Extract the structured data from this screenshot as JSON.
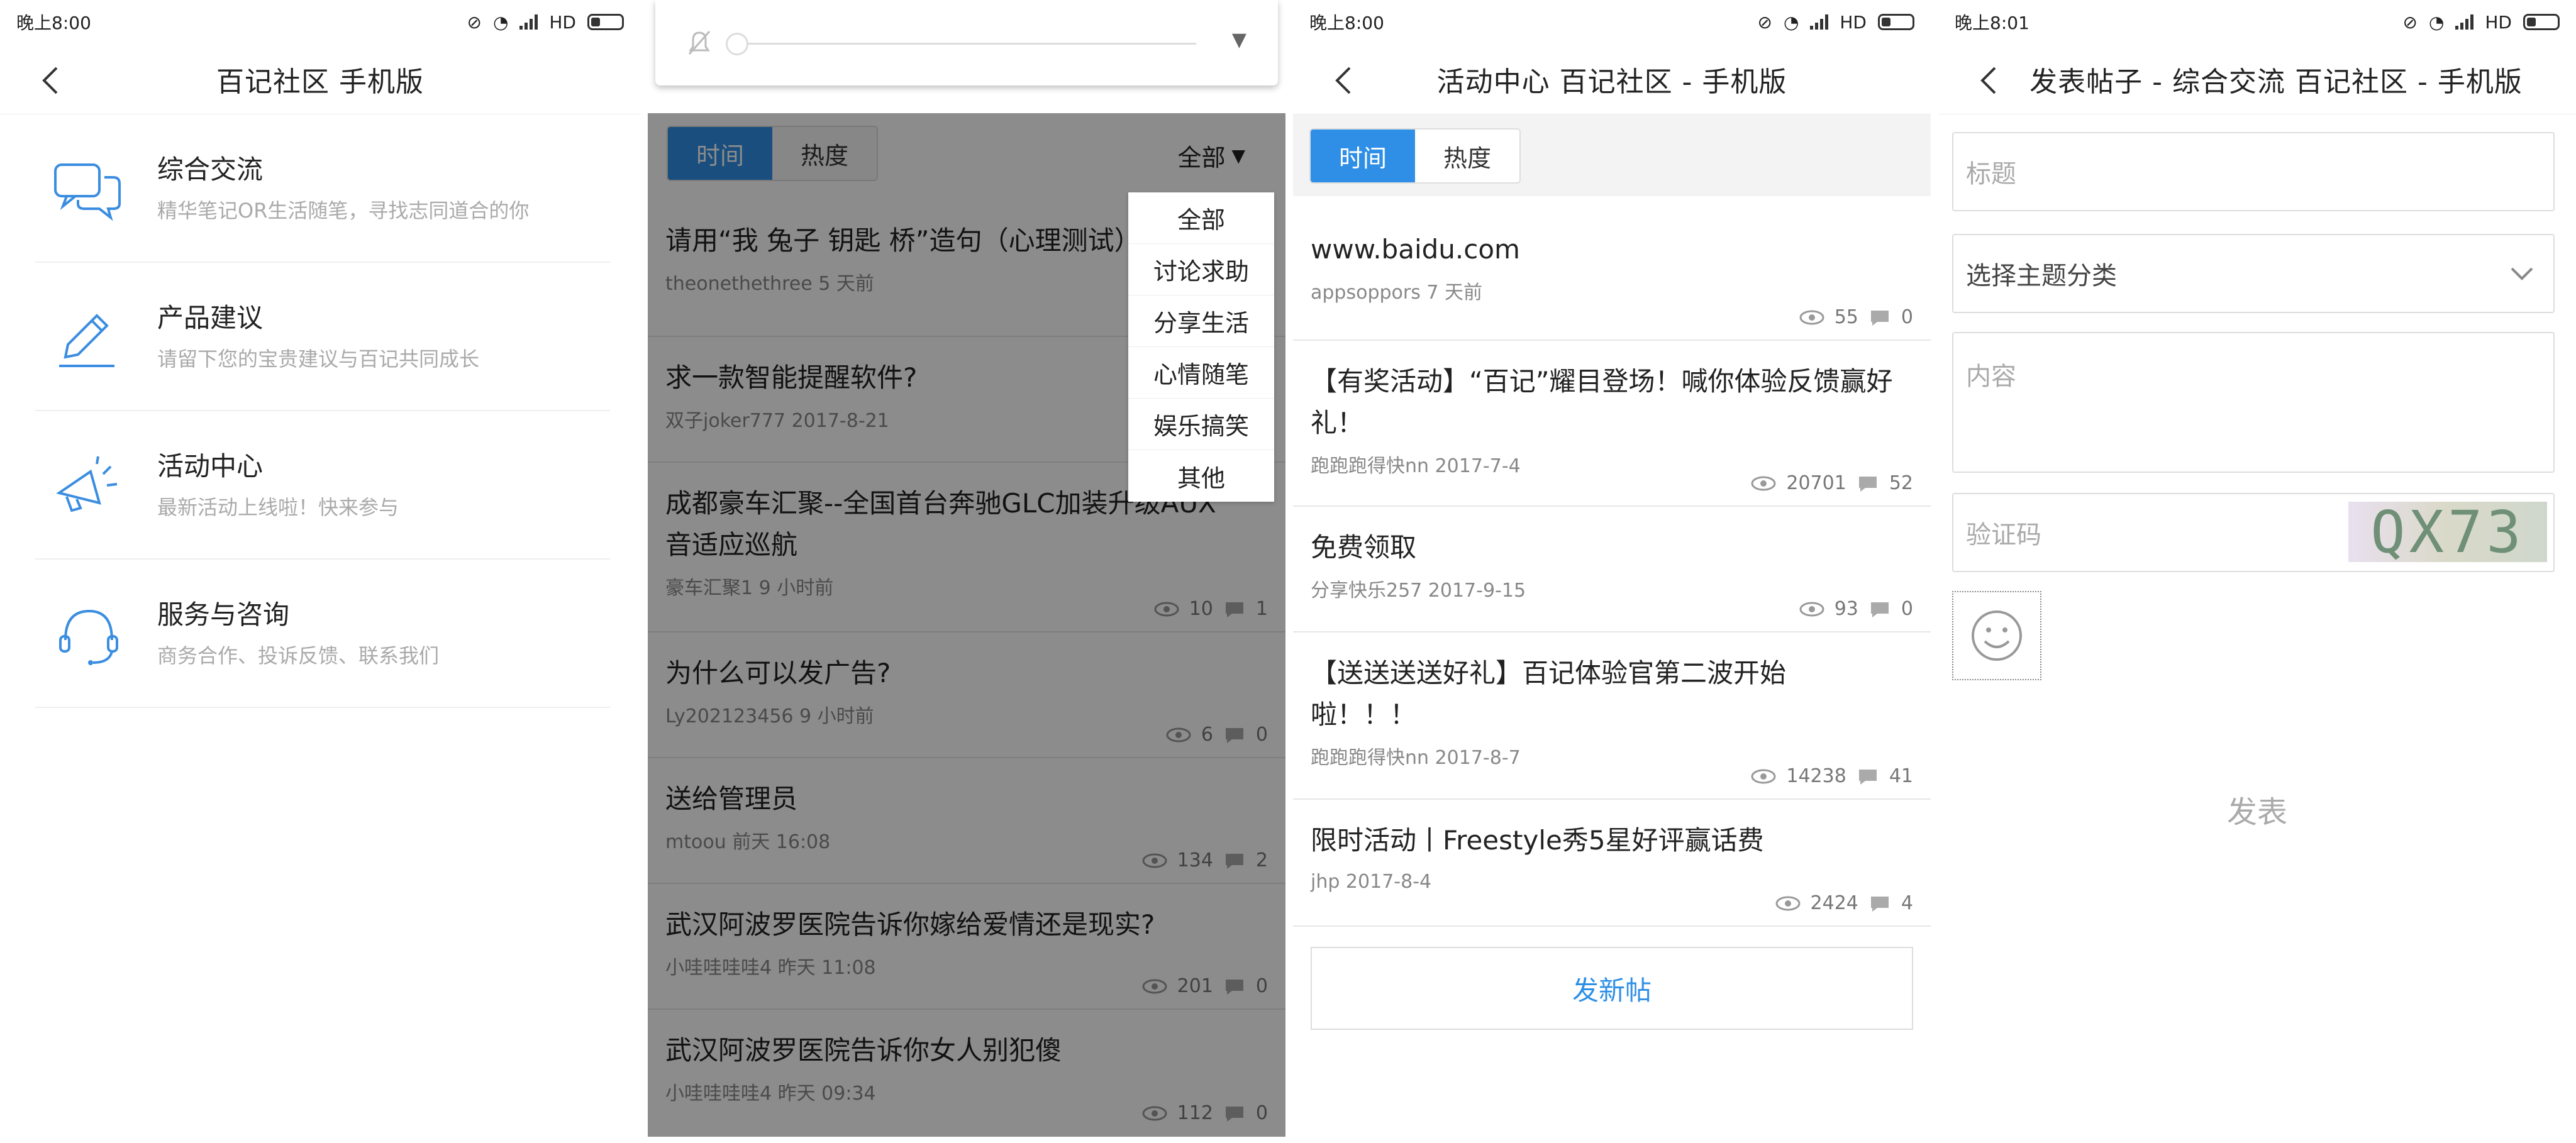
{
  "status_p1": {
    "time": "晚上8:00",
    "net": "HD"
  },
  "status_p3": {
    "time": "晚上8:00",
    "net": "HD"
  },
  "status_p4": {
    "time": "晚上8:01",
    "net": "HD"
  },
  "p1": {
    "title": "百记社区 手机版",
    "items": [
      {
        "name": "综合交流",
        "desc": "精华笔记OR生活随笔，寻找志同道合的你",
        "icon": "chat-icon"
      },
      {
        "name": "产品建议",
        "desc": "请留下您的宝贵建议与百记共同成长",
        "icon": "pen-icon"
      },
      {
        "name": "活动中心",
        "desc": "最新活动上线啦！快来参与",
        "icon": "megaphone-icon"
      },
      {
        "name": "服务与咨询",
        "desc": "商务合作、投诉反馈、联系我们",
        "icon": "headset-icon"
      }
    ]
  },
  "p2": {
    "tabs": {
      "time": "时间",
      "hot": "热度"
    },
    "filter": "全部",
    "dropdown": [
      "全部",
      "讨论求助",
      "分享生活",
      "心情随笔",
      "娱乐搞笑",
      "其他"
    ],
    "rows": [
      {
        "title": "请用“我 兔子 钥匙 桥”造句（心理测试）",
        "meta": "theonethethree 5 天前",
        "views": "",
        "comments": ""
      },
      {
        "title": "求一款智能提醒软件?",
        "meta": "双子joker777 2017-8-21",
        "views": "",
        "comments": ""
      },
      {
        "title": "成都豪车汇聚--全国首台奔驰GLC加装升级AUX音适应巡航",
        "meta": "豪车汇聚1 9 小时前",
        "views": "10",
        "comments": "1"
      },
      {
        "title": "为什么可以发广告?",
        "meta": "Ly202123456 9 小时前",
        "views": "6",
        "comments": "0"
      },
      {
        "title": "送给管理员",
        "meta": "mtoou 前天 16:08",
        "views": "134",
        "comments": "2"
      },
      {
        "title": "武汉阿波罗医院告诉你嫁给爱情还是现实?",
        "meta": "小哇哇哇哇4 昨天 11:08",
        "views": "201",
        "comments": "0"
      },
      {
        "title": "武汉阿波罗医院告诉你女人别犯傻",
        "meta": "小哇哇哇哇4 昨天 09:34",
        "views": "112",
        "comments": "0"
      }
    ]
  },
  "p3": {
    "title": "活动中心 百记社区 - 手机版",
    "tabs": {
      "time": "时间",
      "hot": "热度"
    },
    "rows": [
      {
        "title": "www.baidu.com",
        "meta": "appsoppors 7 天前",
        "views": "55",
        "comments": "0"
      },
      {
        "title": "【有奖活动】“百记”耀目登场！喊你体验反馈赢好礼！",
        "meta": "跑跑跑得快nn 2017-7-4",
        "views": "20701",
        "comments": "52"
      },
      {
        "title": "免费领取",
        "meta": "分享快乐257 2017-9-15",
        "views": "93",
        "comments": "0"
      },
      {
        "title": "【送送送送好礼】百记体验官第二波开始啦！！！",
        "meta": "跑跑跑得快nn 2017-8-7",
        "views": "14238",
        "comments": "41"
      },
      {
        "title": "限时活动丨Freestyle秀5星好评赢话费",
        "meta": "jhp 2017-8-4",
        "views": "2424",
        "comments": "4"
      }
    ],
    "new_post": "发新帖"
  },
  "p4": {
    "title": "发表帖子 - 综合交流 百记社区 - 手机版",
    "title_placeholder": "标题",
    "category_placeholder": "选择主题分类",
    "content_placeholder": "内容",
    "captcha_placeholder": "验证码",
    "captcha_text": "QX73",
    "publish": "发表"
  }
}
